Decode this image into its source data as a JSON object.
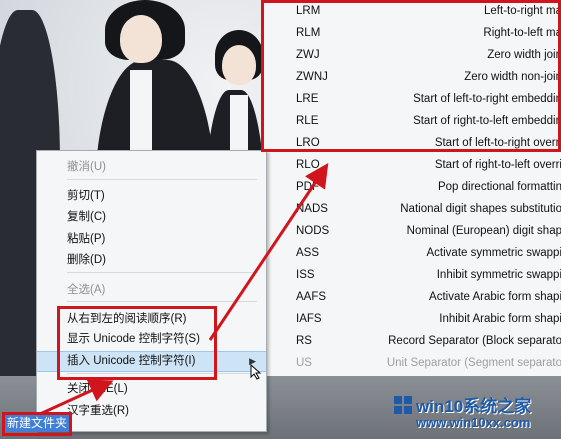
{
  "context_menu": {
    "items": [
      {
        "label": "撤消(U)",
        "disabled": true
      },
      {
        "label": "剪切(T)",
        "disabled": false
      },
      {
        "label": "复制(C)",
        "disabled": false
      },
      {
        "label": "粘贴(P)",
        "disabled": false
      },
      {
        "label": "删除(D)",
        "disabled": false
      },
      {
        "label": "全选(A)",
        "disabled": true
      },
      {
        "label": "从右到左的阅读顺序(R)",
        "disabled": false
      },
      {
        "label": "显示 Unicode 控制字符(S)",
        "disabled": false
      },
      {
        "label": "插入 Unicode 控制字符(I)",
        "disabled": false,
        "highlighted": true,
        "has_submenu": true
      },
      {
        "label": "关闭 IME(L)",
        "disabled": false
      },
      {
        "label": "汉字重选(R)",
        "disabled": false
      }
    ]
  },
  "submenu": {
    "rows": [
      {
        "code": "LRM",
        "desc": "Left-to-right ma"
      },
      {
        "code": "RLM",
        "desc": "Right-to-left ma"
      },
      {
        "code": "ZWJ",
        "desc": "Zero width join"
      },
      {
        "code": "ZWNJ",
        "desc": "Zero width non-join"
      },
      {
        "code": "LRE",
        "desc": "Start of left-to-right embeddin"
      },
      {
        "code": "RLE",
        "desc": "Start of right-to-left embeddin"
      },
      {
        "code": "LRO",
        "desc": "Start of left-to-right overri"
      },
      {
        "code": "RLO",
        "desc": "Start of right-to-left overri"
      },
      {
        "code": "PDF",
        "desc": "Pop directional formattin"
      },
      {
        "code": "NADS",
        "desc": "National digit shapes substitutio"
      },
      {
        "code": "NODS",
        "desc": "Nominal (European) digit shap"
      },
      {
        "code": "ASS",
        "desc": "Activate symmetric swappi"
      },
      {
        "code": "ISS",
        "desc": "Inhibit symmetric swappi"
      },
      {
        "code": "AAFS",
        "desc": "Activate Arabic form shapi"
      },
      {
        "code": "IAFS",
        "desc": "Inhibit Arabic form shapi"
      },
      {
        "code": "RS",
        "desc": "Record Separator (Block separato"
      },
      {
        "code": "US",
        "desc": "Unit Separator (Segment separato"
      }
    ]
  },
  "selected_text": "新建文件夹",
  "watermark": {
    "title": "win10系统之家",
    "url": "www.win10xx.com"
  },
  "colors": {
    "annotation_red": "#d0161c",
    "highlight": "#cde4f7",
    "selection": "#3f7fd6",
    "watermark": "#1e5aa8"
  }
}
